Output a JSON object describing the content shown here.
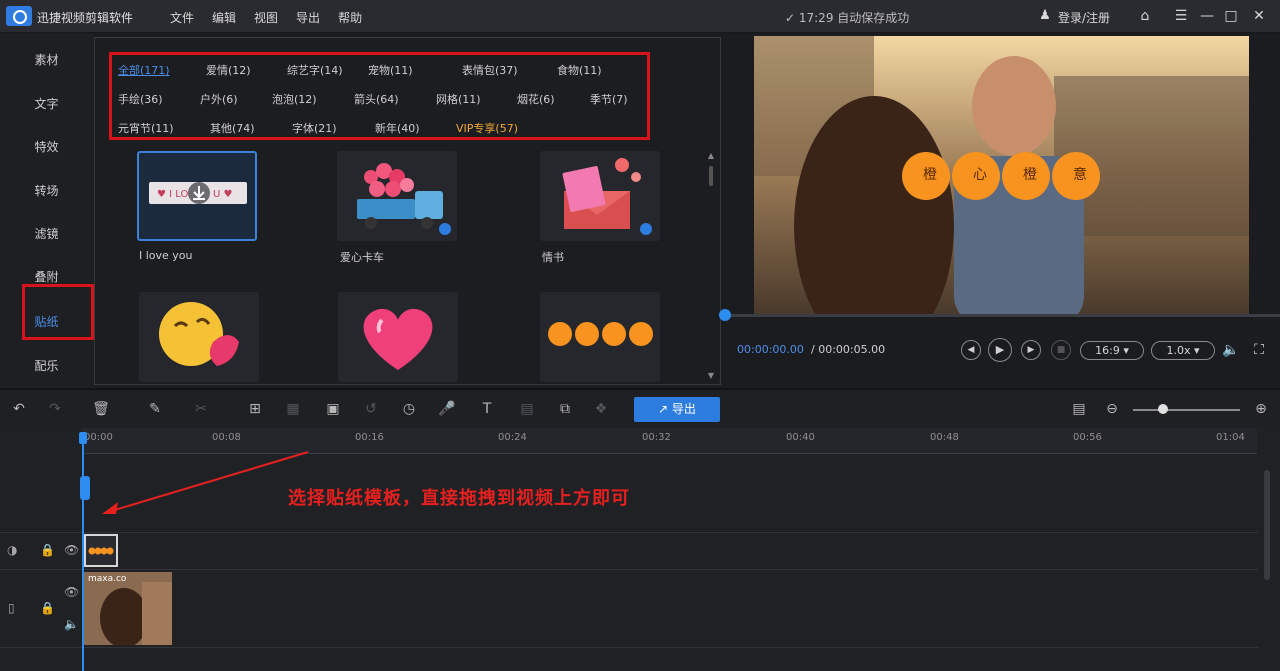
{
  "app": {
    "title": "迅捷视频剪辑软件",
    "menu": [
      "文件",
      "编辑",
      "视图",
      "导出",
      "帮助"
    ],
    "autosave": "✓ 17:29 自动保存成功",
    "login": "登录/注册"
  },
  "leftnav": {
    "items": [
      "素材",
      "文字",
      "特效",
      "转场",
      "滤镜",
      "叠附",
      "贴纸",
      "配乐"
    ],
    "active": "贴纸"
  },
  "categories": [
    [
      "全部(171)",
      "爱情(12)",
      "综艺字(14)",
      "宠物(11)",
      "表情包(37)",
      "食物(11)"
    ],
    [
      "手绘(36)",
      "户外(6)",
      "泡泡(12)",
      "箭头(64)",
      "网格(11)",
      "烟花(6)",
      "季节(7)"
    ],
    [
      "元宵节(11)",
      "其他(74)",
      "字体(21)",
      "新年(40)",
      "VIP专享(57)"
    ]
  ],
  "stickers": [
    {
      "label": "I love you",
      "icon": "i-love-you-banner-icon",
      "selected": true
    },
    {
      "label": "爱心卡车",
      "icon": "heart-truck-icon",
      "selected": false
    },
    {
      "label": "情书",
      "icon": "love-letter-icon",
      "selected": false
    },
    {
      "label": "",
      "icon": "kiss-emoji-icon",
      "selected": false
    },
    {
      "label": "",
      "icon": "pink-heart-icon",
      "selected": false
    },
    {
      "label": "",
      "icon": "orange-row-icon",
      "selected": false
    }
  ],
  "preview": {
    "overlay_chars": [
      "橙",
      "心",
      "橙",
      "意"
    ],
    "time_current": "00:00:00.00",
    "time_total": "/ 00:00:05.00",
    "aspect": "16:9",
    "speed": "1.0x"
  },
  "toolbar": {
    "export_label": "导出"
  },
  "ruler": {
    "ticks": [
      "00:00",
      "00:08",
      "00:16",
      "00:24",
      "00:32",
      "00:40",
      "00:48",
      "00:56",
      "01:04"
    ]
  },
  "annotation": "选择贴纸模板，直接拖拽到视频上方即可",
  "timeline": {
    "video_clip_tag": "maxa.co"
  },
  "colors": {
    "accent": "#2d7de0",
    "highlight_red": "#d7141a",
    "vip": "#f0a838"
  }
}
